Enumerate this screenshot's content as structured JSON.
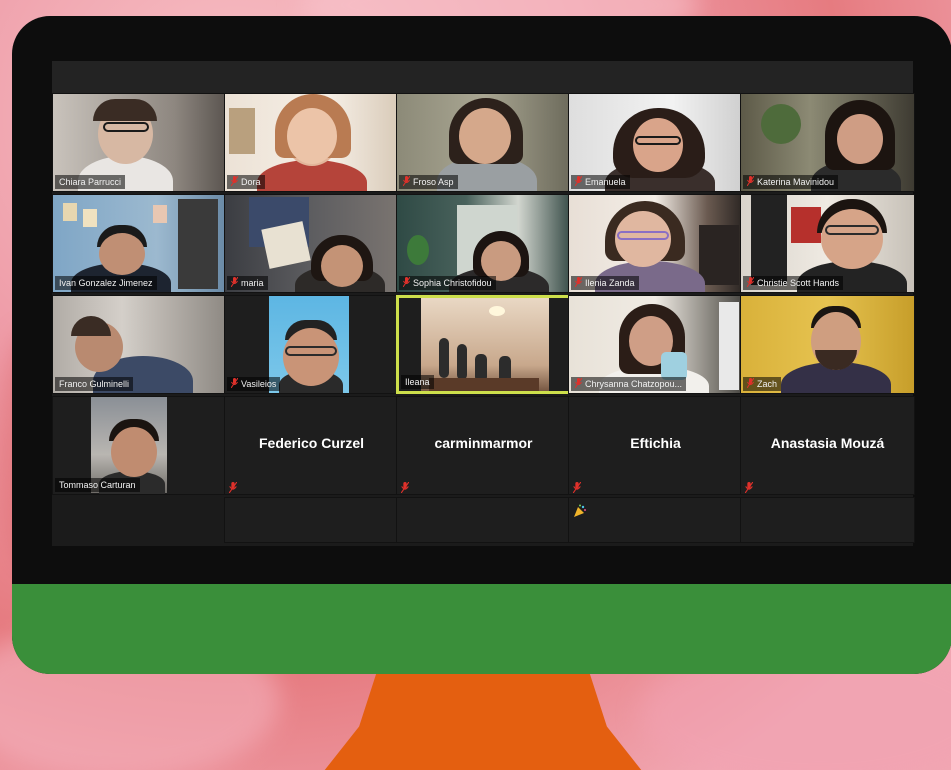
{
  "colors": {
    "monitor_frame": "#0d0d0d",
    "monitor_chin": "#3a8f3a",
    "stand": "#e45f10",
    "active_speaker_border": "#cddf4b",
    "mute_icon": "#e0312b"
  },
  "participants": [
    {
      "name": "Chiara Parrucci",
      "muted": false
    },
    {
      "name": "Dora",
      "muted": true
    },
    {
      "name": "Froso Asp",
      "muted": true
    },
    {
      "name": "Emanuela",
      "muted": true
    },
    {
      "name": "Katerina Mavinidou",
      "muted": true
    },
    {
      "name": "Ivan Gonzalez Jimenez",
      "muted": false
    },
    {
      "name": "maria",
      "muted": true
    },
    {
      "name": "Sophia Christofidou",
      "muted": true
    },
    {
      "name": "Ilenia Zanda",
      "muted": true
    },
    {
      "name": "Christie Scott Hands",
      "muted": true
    },
    {
      "name": "Franco Gulminelli",
      "muted": false
    },
    {
      "name": "Vasileios",
      "muted": true
    },
    {
      "name": "Ileana",
      "muted": false,
      "active_speaker": true
    },
    {
      "name": "Chrysanna Chatzopou...",
      "muted": true
    },
    {
      "name": "Zach",
      "muted": true
    },
    {
      "name": "Tommaso Carturan",
      "muted": false
    }
  ],
  "no_video": [
    {
      "name": "Federico Curzel",
      "muted": true
    },
    {
      "name": "carminmarmor",
      "muted": true
    },
    {
      "name": "Eftichia",
      "muted": true
    },
    {
      "name": "Anastasia Mouzá",
      "muted": true
    }
  ],
  "reaction_icon": "party-popper-icon"
}
